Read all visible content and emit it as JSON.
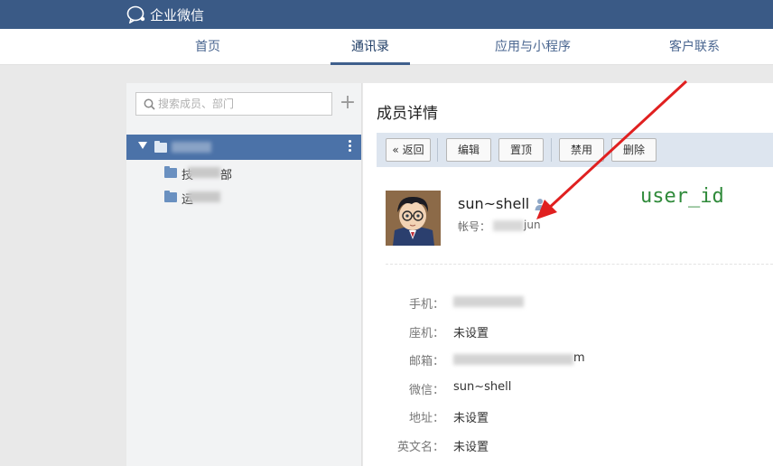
{
  "app": {
    "brand": "企业微信"
  },
  "nav": {
    "tabs": [
      {
        "label": "首页"
      },
      {
        "label": "通讯录"
      },
      {
        "label": "应用与小程序"
      },
      {
        "label": "客户联系"
      }
    ],
    "active_index": 1
  },
  "sidebar": {
    "search_placeholder": "搜索成员、部门",
    "children": [
      {
        "label_prefix": "技",
        "label_suffix": "部"
      },
      {
        "label_prefix": "运",
        "label_suffix": ""
      }
    ]
  },
  "detail": {
    "title": "成员详情",
    "toolbar": {
      "back_label": "返回",
      "edit_label": "编辑",
      "top_label": "置顶",
      "disable_label": "禁用",
      "delete_label": "删除"
    },
    "member_name": "sun~shell",
    "account_label": "帐号：",
    "account_suffix": "jun",
    "annotation": "user_id",
    "fields": [
      {
        "label": "手机：",
        "value": ""
      },
      {
        "label": "座机：",
        "value": "未设置"
      },
      {
        "label": "邮箱：",
        "value": "m"
      },
      {
        "label": "微信：",
        "value": "sun~shell"
      },
      {
        "label": "地址：",
        "value": "未设置"
      },
      {
        "label": "英文名：",
        "value": "未设置"
      }
    ]
  },
  "colors": {
    "topbar": "#3a5a86",
    "selected_row": "#4b72a8",
    "toolbar_bg": "#dde5ef",
    "annotation": "#2f8a3a",
    "arrow": "#e02020"
  }
}
